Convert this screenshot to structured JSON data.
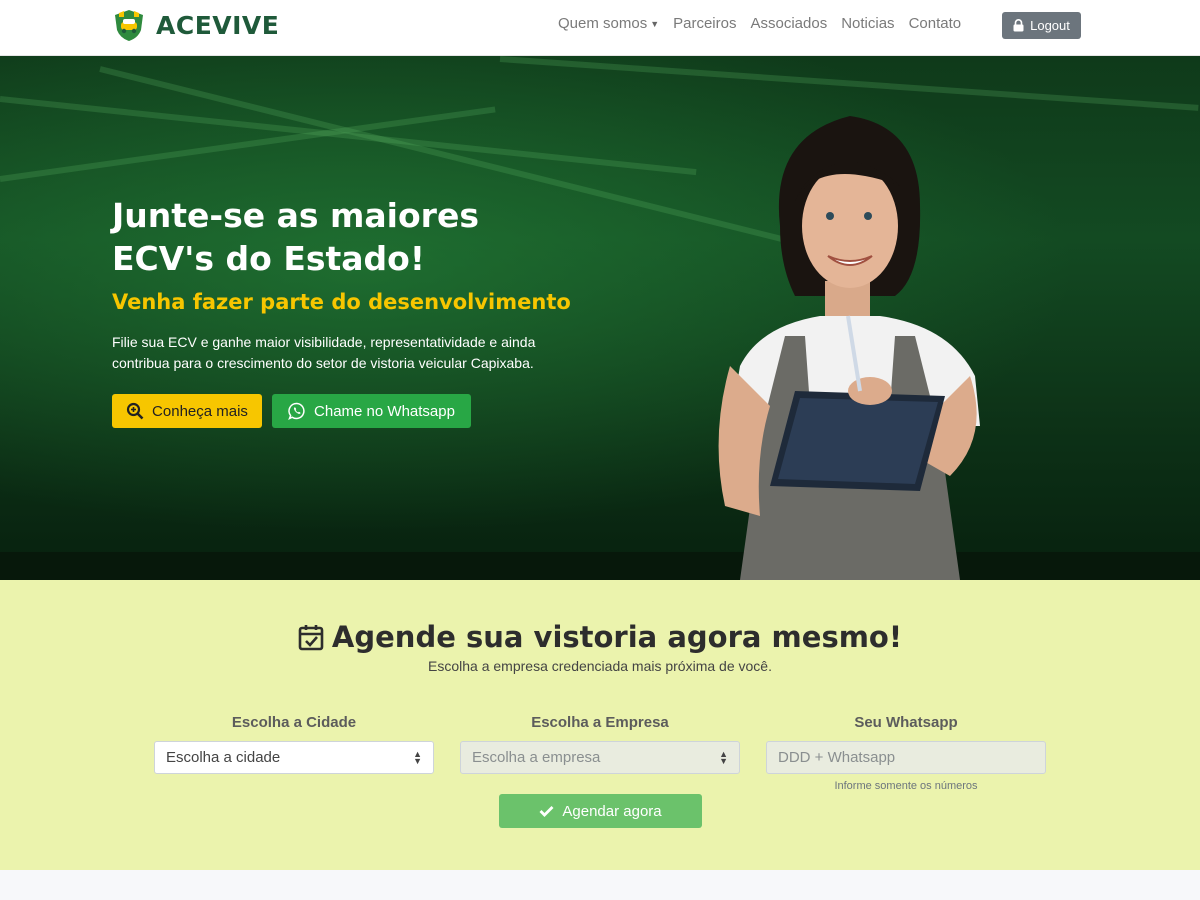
{
  "brand": {
    "name": "ACEVIVE",
    "logo_icon": "shield-car-icon"
  },
  "nav": {
    "items": [
      {
        "label": "Quem somos",
        "has_dropdown": true
      },
      {
        "label": "Parceiros"
      },
      {
        "label": "Associados"
      },
      {
        "label": "Noticias"
      },
      {
        "label": "Contato"
      }
    ],
    "logout_label": "Logout",
    "logout_icon": "lock-icon"
  },
  "hero": {
    "title": "Junte-se as maiores ECV's do Estado!",
    "subtitle": "Venha fazer parte do desenvolvimento",
    "description": "Filie sua ECV e ganhe maior visibilidade, representatividade e ainda contribua para o crescimento do setor de vistoria veicular Capixaba.",
    "btn_know_more": "Conheça mais",
    "btn_whatsapp": "Chame no Whatsapp"
  },
  "booking": {
    "title": "Agende sua vistoria agora mesmo!",
    "subtitle": "Escolha a empresa credenciada mais próxima de você.",
    "city": {
      "label": "Escolha a Cidade",
      "selected": "Escolha a cidade"
    },
    "company": {
      "label": "Escolha a Empresa",
      "selected": "Escolha a empresa"
    },
    "whatsapp": {
      "label": "Seu Whatsapp",
      "placeholder": "DDD + Whatsapp",
      "hint": "Informe somente os números"
    },
    "submit_label": "Agendar agora"
  },
  "colors": {
    "brand_green": "#1f5a3a",
    "accent_yellow": "#f7c600",
    "whatsapp_green": "#28a745",
    "booking_bg": "#ebf3ad",
    "submit_green": "#6bc26b"
  }
}
